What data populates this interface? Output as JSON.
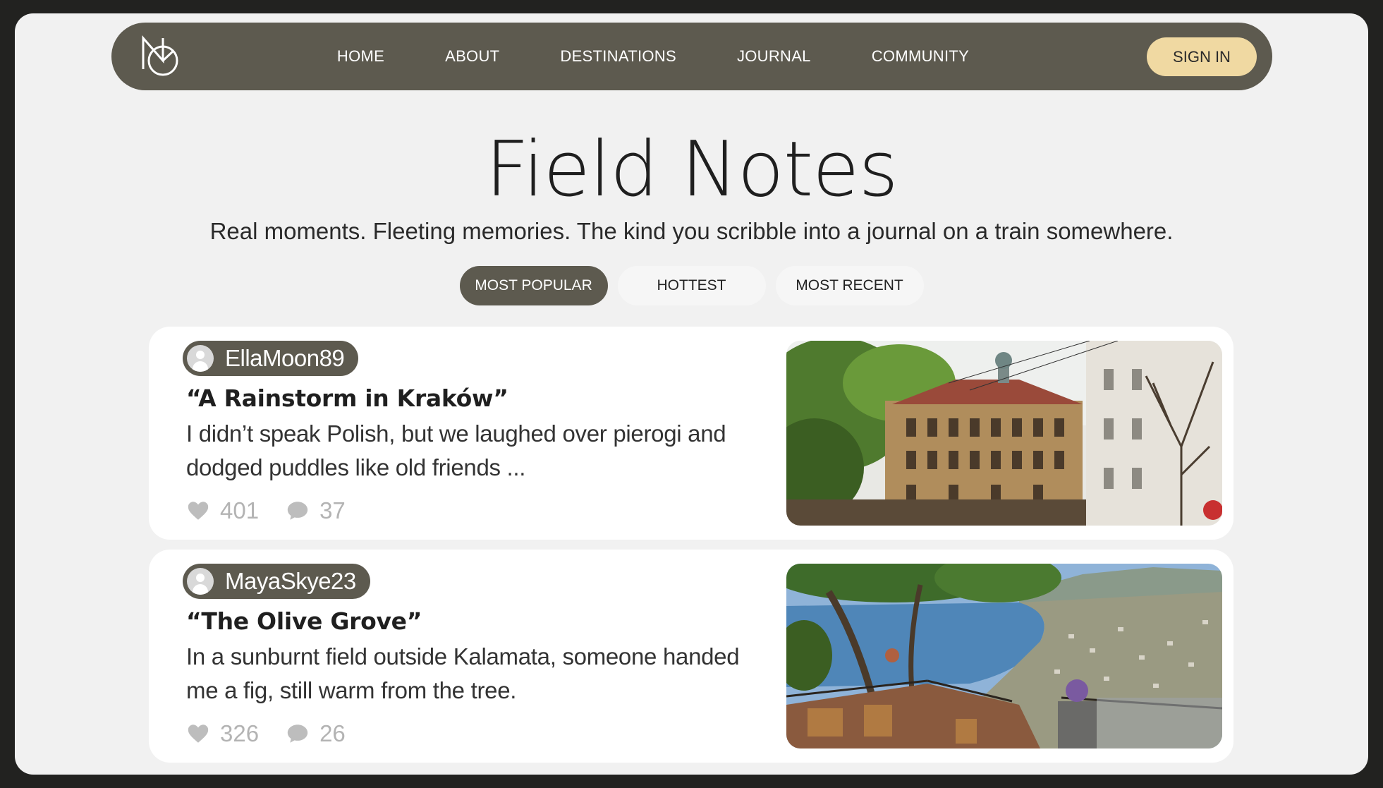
{
  "nav": {
    "links": [
      "HOME",
      "ABOUT",
      "DESTINATIONS",
      "JOURNAL",
      "COMMUNITY"
    ],
    "sign_in": "SIGN IN"
  },
  "header": {
    "title": "Field Notes",
    "subtitle": "Real moments. Fleeting memories. The kind you scribble into a journal on a train somewhere."
  },
  "tabs": [
    {
      "label": "MOST POPULAR",
      "active": true
    },
    {
      "label": "HOTTEST",
      "active": false
    },
    {
      "label": "MOST RECENT",
      "active": false
    }
  ],
  "posts": [
    {
      "author": "EllaMoon89",
      "title": "“A Rainstorm in Kraków”",
      "excerpt": "I didn’t speak Polish, but we laughed over pierogi and dodged puddles like old friends ...",
      "likes": "401",
      "comments": "37"
    },
    {
      "author": "MayaSkye23",
      "title": "“The Olive Grove”",
      "excerpt": "In a sunburnt field outside Kalamata, someone handed me a fig, still warm from the tree.",
      "likes": "326",
      "comments": "26"
    }
  ],
  "colors": {
    "nav_bg": "#5d5a4f",
    "accent": "#f0d9a2",
    "page_bg": "#f1f1f1",
    "card_bg": "#ffffff",
    "muted": "#b3b3b3"
  },
  "icons": {
    "logo": "monogram-logo-icon",
    "like": "heart-icon",
    "comment": "speech-bubble-icon",
    "avatar": "user-avatar-icon"
  }
}
